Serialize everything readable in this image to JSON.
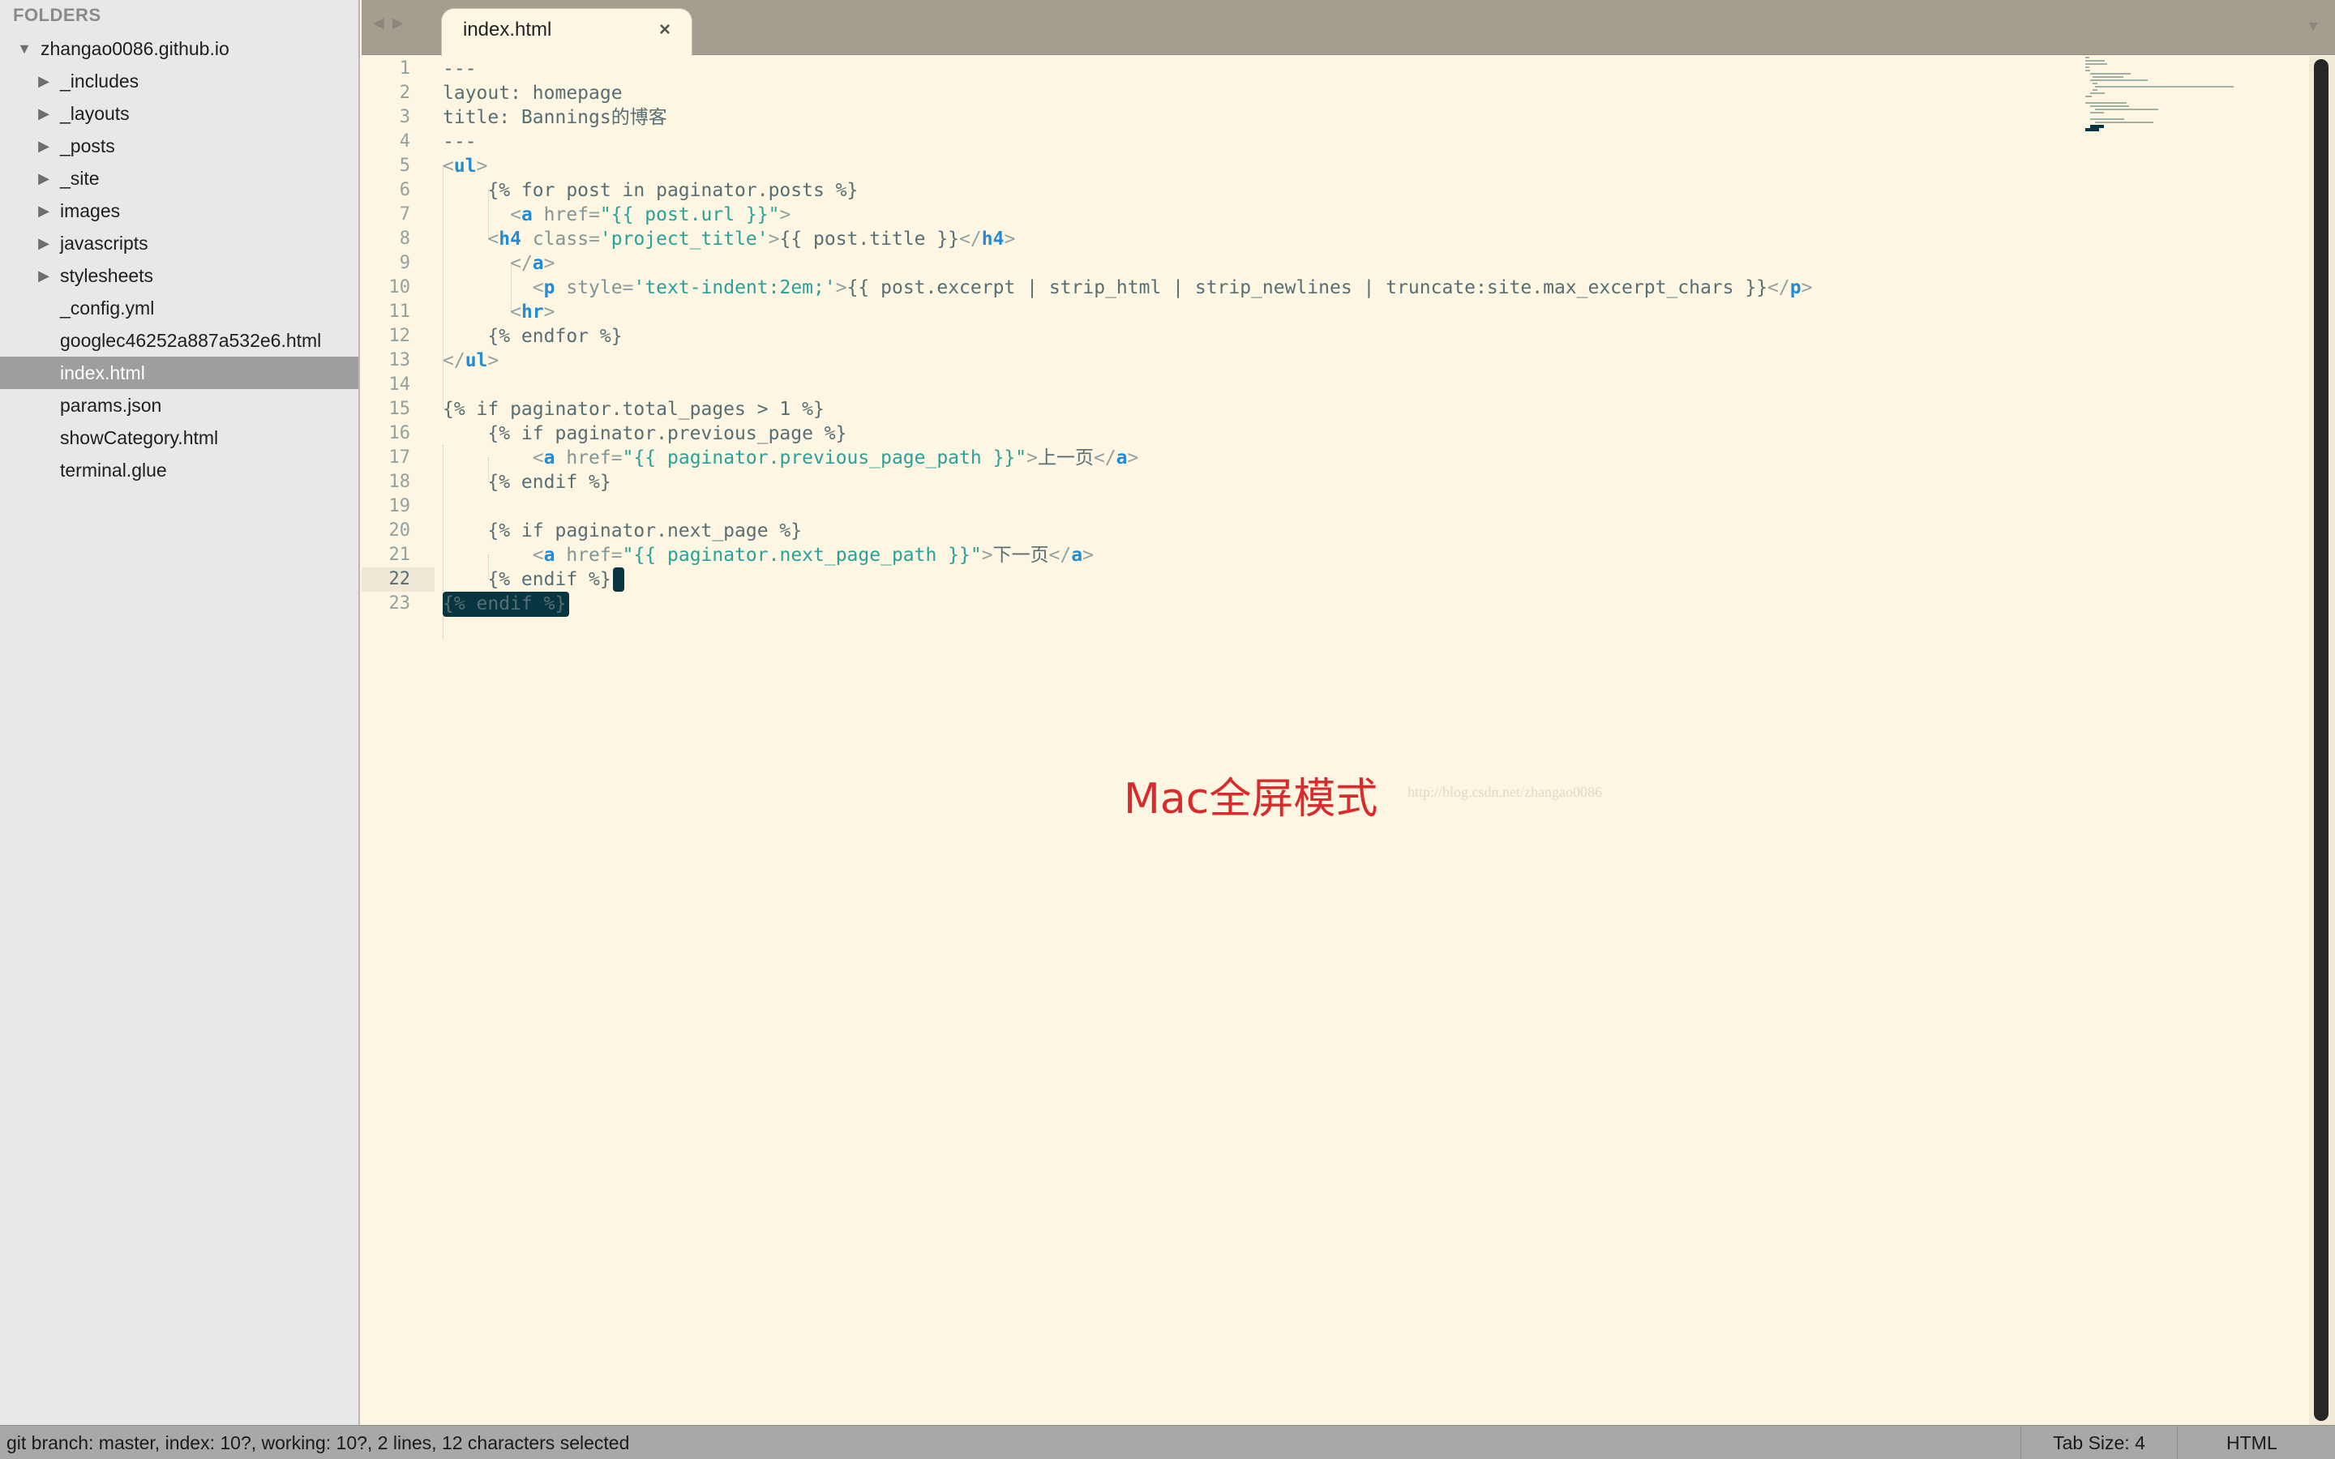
{
  "sidebar": {
    "header": "FOLDERS",
    "root": "zhangao0086.github.io",
    "folders": [
      "_includes",
      "_layouts",
      "_posts",
      "_site",
      "images",
      "javascripts",
      "stylesheets"
    ],
    "files": [
      "_config.yml",
      "googlec46252a887a532e6.html",
      "index.html",
      "params.json",
      "showCategory.html",
      "terminal.glue"
    ],
    "selected_file": "index.html"
  },
  "tabs": [
    {
      "label": "index.html",
      "close_icon": "×"
    }
  ],
  "editor": {
    "line_count": 23,
    "current_line": 22,
    "lines": [
      "---",
      "layout: homepage",
      "title: Bannings的博客",
      "---",
      "<ul>",
      "    {% for post in paginator.posts %}",
      "      <a href=\"{{ post.url }}\">",
      "    <h4 class='project_title'>{{ post.title }}</h4>",
      "      </a>",
      "        <p style='text-indent:2em;'>{{ post.excerpt | strip_html | strip_newlines | truncate:site.max_excerpt_chars }}</p>",
      "      <hr>",
      "    {% endfor %}",
      "</ul>",
      "",
      "{% if paginator.total_pages > 1 %}",
      "    {% if paginator.previous_page %}",
      "        <a href=\"{{ paginator.previous_page_path }}\">上一页</a>",
      "    {% endif %}",
      "",
      "    {% if paginator.next_page %}",
      "        <a href=\"{{ paginator.next_page_path }}\">下一页</a>",
      "    {% endif %}",
      "{% endif %}"
    ],
    "selection_lines": [
      22,
      23
    ],
    "overlay_text": "Mac全屏模式",
    "overlay_url": "http://blog.csdn.net/zhangao0086"
  },
  "statusbar": {
    "text": "git branch: master, index: 10?, working: 10?, 2 lines, 12 characters selected",
    "tab_size": "Tab Size: 4",
    "syntax": "HTML"
  },
  "colors": {
    "background": "#FDF6E3",
    "tag": "#268BD2",
    "string": "#2AA198",
    "text": "#586E75",
    "selection": "#073642",
    "watermark": "#D92B2B"
  },
  "icons": {
    "expand": "triangle-right-icon",
    "collapse": "triangle-down-icon",
    "close": "close-icon"
  }
}
